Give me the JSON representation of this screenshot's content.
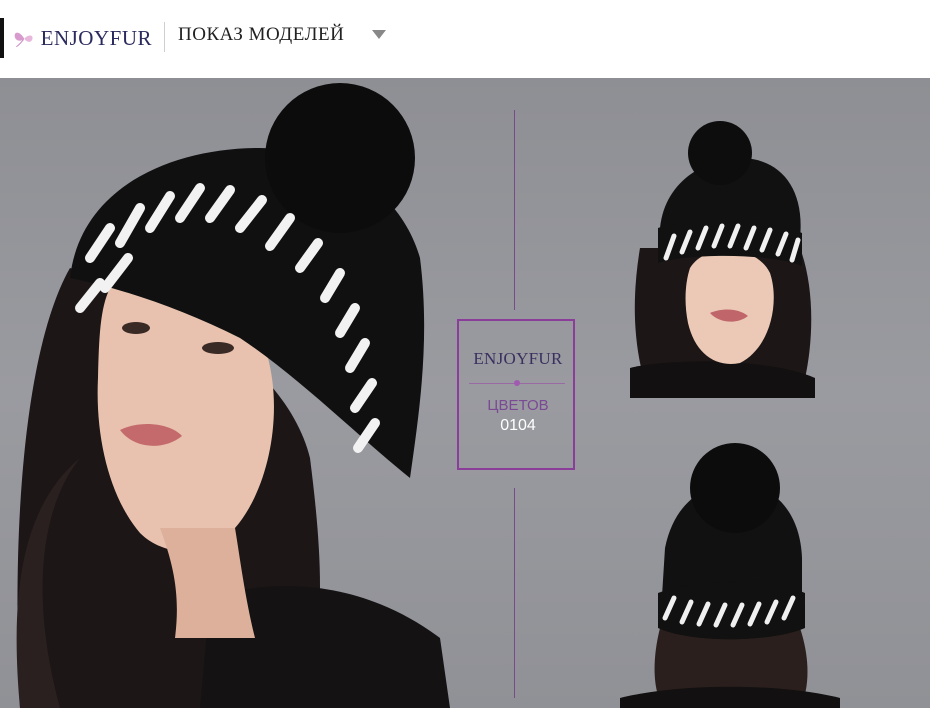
{
  "header": {
    "logo_text": "ENJOYFUR",
    "nav_title": "ПОКАЗ МОДЕЛЕЙ",
    "dropdown_icon": "caret-down-icon"
  },
  "product": {
    "brand": "ENJOYFUR",
    "label": "ЦВЕТОВ",
    "code": "0104"
  },
  "images": [
    {
      "name": "model-main-photo",
      "alt": "Model wearing black and white knitted mink fur hat with fox pom-pom"
    },
    {
      "name": "model-front-photo",
      "alt": "Front view of model in fur hat"
    },
    {
      "name": "model-back-photo",
      "alt": "Back view of fur hat"
    }
  ],
  "colors": {
    "accent": "#8a3e99",
    "background": "#9a9ba0",
    "brand_text": "#2a2a5e"
  }
}
